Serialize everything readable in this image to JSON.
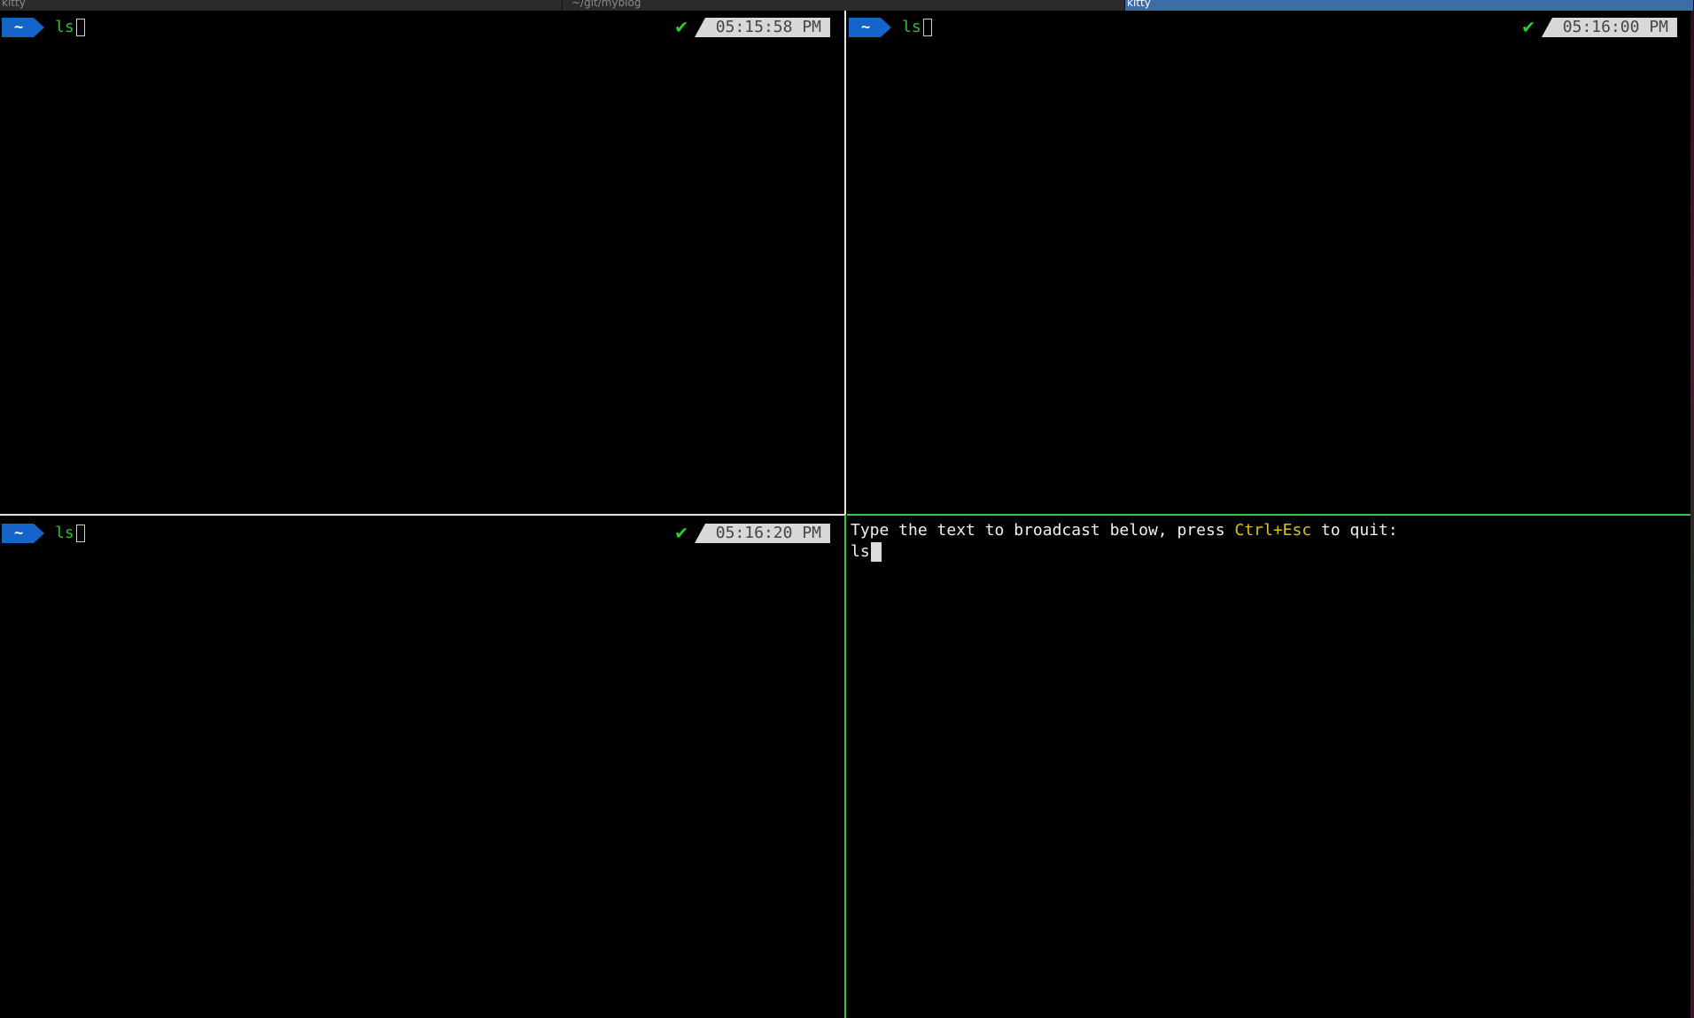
{
  "tabs": [
    {
      "title": "kitty",
      "active": false
    },
    {
      "title": "~/git/myblog",
      "active": false
    },
    {
      "title": "kitty",
      "active": true
    }
  ],
  "panes": {
    "top_left": {
      "dir": "~",
      "command": "ls",
      "status": "✔",
      "time": "05:15:58 PM"
    },
    "top_right": {
      "dir": "~",
      "command": "ls",
      "status": "✔",
      "time": "05:16:00 PM"
    },
    "bottom_left": {
      "dir": "~",
      "command": "ls",
      "status": "✔",
      "time": "05:16:20 PM"
    }
  },
  "broadcast": {
    "prefix": "Type the text to broadcast below, press ",
    "key": "Ctrl+Esc",
    "suffix": " to quit:",
    "input": "ls"
  },
  "colors": {
    "prompt_dir_bg": "#1565c8",
    "command_text": "#2bbf2b",
    "status_ok": "#2bd12b",
    "time_bg": "#d8d8d8",
    "active_tab": "#3b6ea6",
    "active_border": "#35c935",
    "key_highlight": "#d8c21a"
  }
}
